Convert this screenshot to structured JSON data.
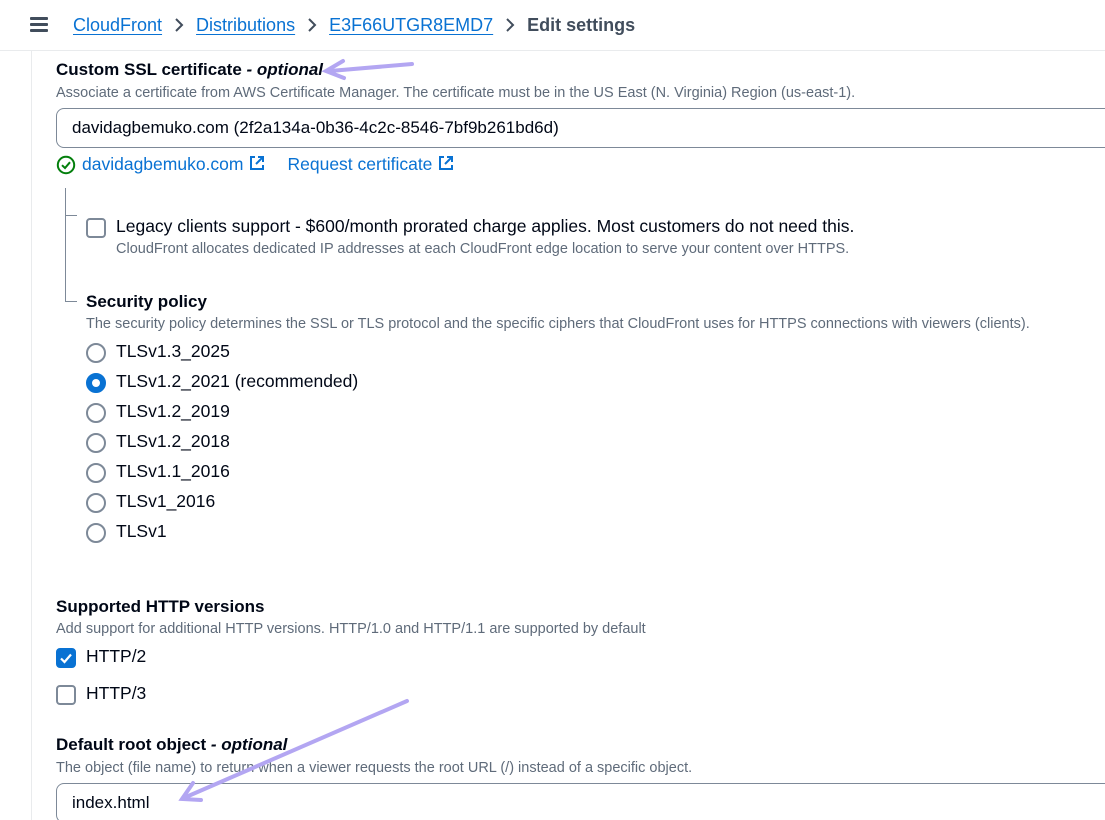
{
  "breadcrumb": {
    "items": [
      "CloudFront",
      "Distributions",
      "E3F66UTGR8EMD7"
    ],
    "current": "Edit settings"
  },
  "ssl": {
    "title": "Custom SSL certificate",
    "title_suffix": "- optional",
    "description": "Associate a certificate from AWS Certificate Manager. The certificate must be in the US East (N. Virginia) Region (us-east-1).",
    "value": "davidagbemuko.com (2f2a134a-0b36-4c2c-8546-7bf9b261bd6d)",
    "domain_link": "davidagbemuko.com",
    "request_link": "Request certificate"
  },
  "legacy": {
    "label": "Legacy clients support - $600/month prorated charge applies. Most customers do not need this.",
    "description": "CloudFront allocates dedicated IP addresses at each CloudFront edge location to serve your content over HTTPS.",
    "checked": false
  },
  "security_policy": {
    "title": "Security policy",
    "description": "The security policy determines the SSL or TLS protocol and the specific ciphers that CloudFront uses for HTTPS connections with viewers (clients).",
    "options": [
      {
        "label": "TLSv1.3_2025",
        "checked": false
      },
      {
        "label": "TLSv1.2_2021 (recommended)",
        "checked": true
      },
      {
        "label": "TLSv1.2_2019",
        "checked": false
      },
      {
        "label": "TLSv1.2_2018",
        "checked": false
      },
      {
        "label": "TLSv1.1_2016",
        "checked": false
      },
      {
        "label": "TLSv1_2016",
        "checked": false
      },
      {
        "label": "TLSv1",
        "checked": false
      }
    ]
  },
  "http_versions": {
    "title": "Supported HTTP versions",
    "description": "Add support for additional HTTP versions. HTTP/1.0 and HTTP/1.1 are supported by default",
    "options": [
      {
        "label": "HTTP/2",
        "checked": true
      },
      {
        "label": "HTTP/3",
        "checked": false
      }
    ]
  },
  "root_object": {
    "title": "Default root object",
    "title_suffix": "- optional",
    "description": "The object (file name) to return when a viewer requests the root URL (/) instead of a specific object.",
    "value": "index.html"
  },
  "colors": {
    "link": "#0972d3",
    "annotation_arrow": "#b3a6f2",
    "success": "#037f0c"
  }
}
